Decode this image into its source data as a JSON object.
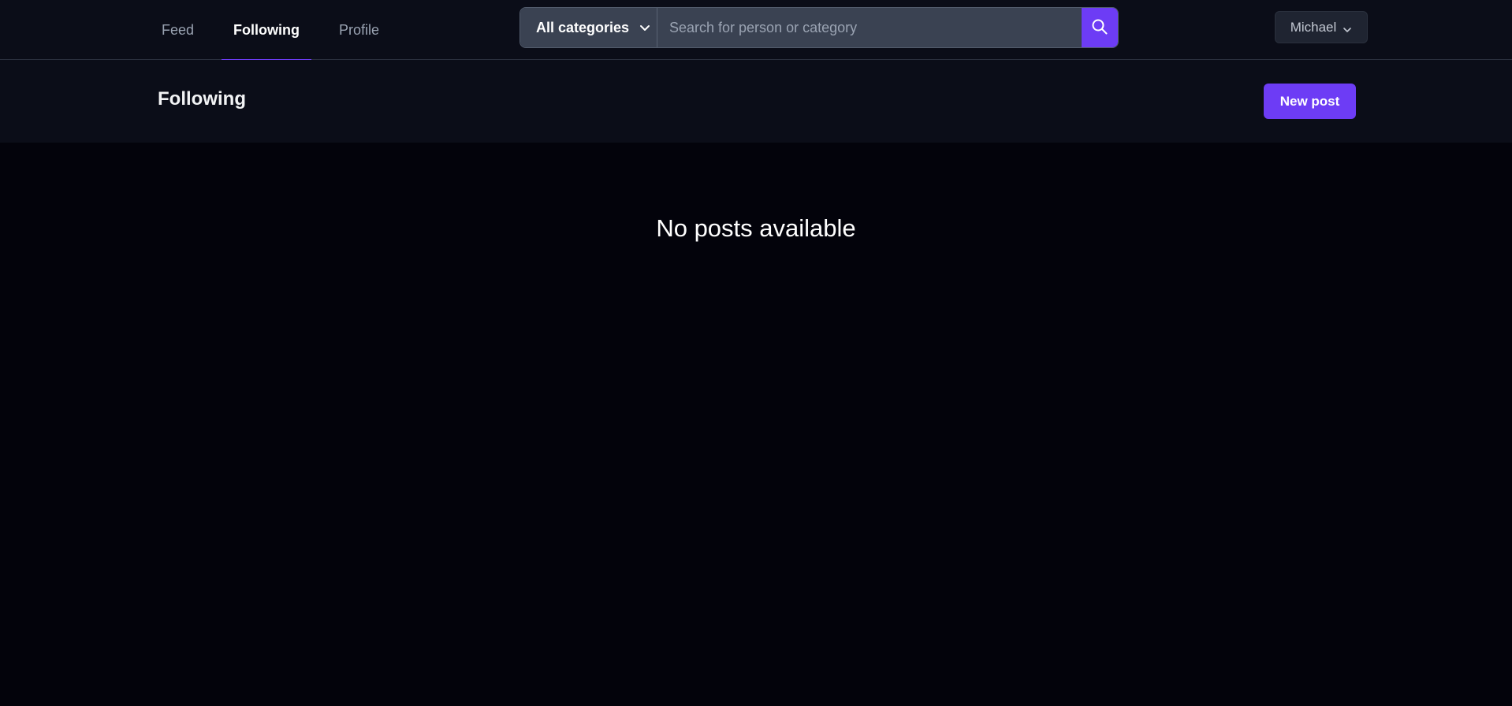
{
  "nav": {
    "tabs": [
      {
        "label": "Feed",
        "active": false
      },
      {
        "label": "Following",
        "active": true
      },
      {
        "label": "Profile",
        "active": false
      }
    ]
  },
  "search": {
    "category_label": "All categories",
    "placeholder": "Search for person or category",
    "value": "",
    "button_icon": "search-icon"
  },
  "user_menu": {
    "name": "Michael",
    "icon": "chevron-down-icon"
  },
  "page": {
    "title": "Following",
    "new_post_label": "New post"
  },
  "content": {
    "empty_message": "No posts available"
  },
  "colors": {
    "accent": "#6d3cf5",
    "background": "#03030b",
    "header_background": "#0b0d18",
    "input_background": "#3a4252"
  }
}
